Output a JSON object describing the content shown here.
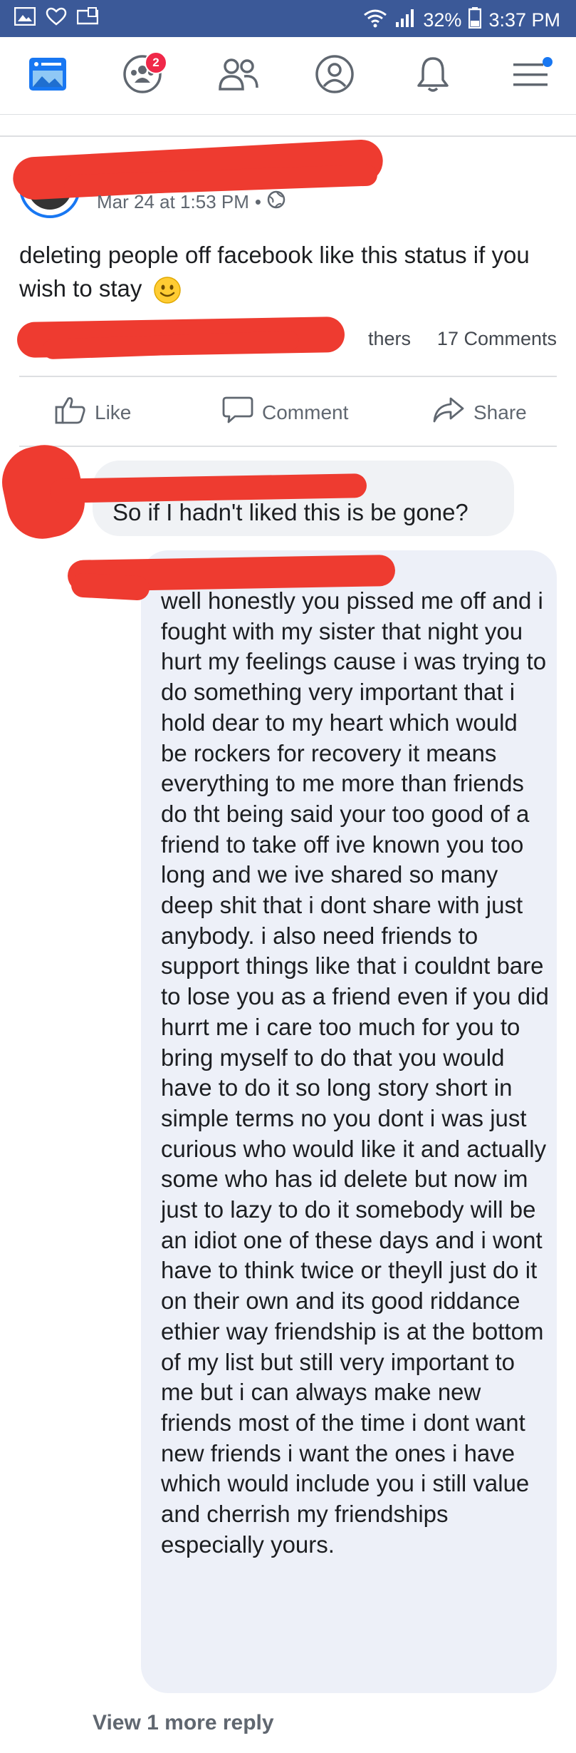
{
  "status_bar": {
    "battery": "32%",
    "time": "3:37 PM",
    "icons": [
      "gallery-icon",
      "heart-icon",
      "tablet-icon",
      "wifi-icon",
      "signal-icon",
      "battery-icon"
    ]
  },
  "nav": {
    "items": [
      {
        "name": "news-feed-icon"
      },
      {
        "name": "groups-icon",
        "badge": "2"
      },
      {
        "name": "friends-icon"
      },
      {
        "name": "profile-icon"
      },
      {
        "name": "notifications-icon"
      },
      {
        "name": "menu-icon"
      }
    ]
  },
  "post": {
    "timestamp": "Mar 24 at 1:53 PM",
    "separator": "•",
    "text": "deleting people off facebook like this status if you wish to stay",
    "stats": {
      "others": "thers",
      "comments": "17 Comments"
    },
    "actions": {
      "like": "Like",
      "comment": "Comment",
      "share": "Share"
    }
  },
  "comments": [
    {
      "text": "So if I hadn't liked this is be gone?"
    },
    {
      "text": "well honestly you pissed me off and i fought with my sister that night you hurt my feelings cause i was trying to do something very important that i hold dear to my heart which would be rockers for recovery it means everything to me more than friends do tht being said your too good of a friend to take off ive known you too long and we ive shared so many deep shit that i dont share with just anybody. i also need friends to support things like that i couldnt bare to lose you as a friend even if you did hurrt me i care too much for you to bring myself to do that you would have to do it so long story short in simple terms no you dont i was just curious who would like it and actually some who has id delete but now im just to lazy to do it somebody will be an idiot one of these days and i wont have to think twice or theyll just do it on their own and its good riddance ethier way friendship is at the bottom of my list but still very important to me but i can always make new friends most of the time i dont want new friends i want the ones i have which would include you i still value and cherrish my friendships especially yours."
    }
  ],
  "view_more": "View 1 more reply",
  "colors": {
    "status_bar": "#3b5998",
    "accent": "#1877f2",
    "redaction": "#ee3b30",
    "badge": "#f02849"
  }
}
